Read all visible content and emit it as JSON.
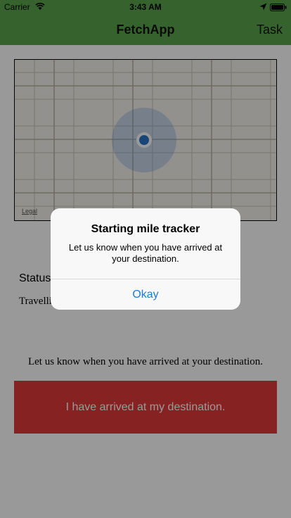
{
  "statusbar": {
    "carrier": "Carrier",
    "time": "3:43 AM"
  },
  "nav": {
    "title": "FetchApp",
    "right_button": "Task"
  },
  "map": {
    "legal_label": "Legal"
  },
  "status": {
    "label": "Status",
    "value": "Travelling"
  },
  "destination": {
    "message": "Let us know when you have arrived at your destination.",
    "button_label": "I have arrived at my destination.",
    "button_color": "#df3a3a"
  },
  "alert": {
    "title": "Starting mile tracker",
    "message": "Let us know when you have arrived at your destination.",
    "button_label": "Okay"
  },
  "colors": {
    "navbar": "#5aa54b",
    "alert_button": "#1f7ad9",
    "location_dot": "#2a76c9"
  },
  "icons": [
    "wifi-icon",
    "location-arrow-icon",
    "battery-icon",
    "user-location-icon"
  ]
}
